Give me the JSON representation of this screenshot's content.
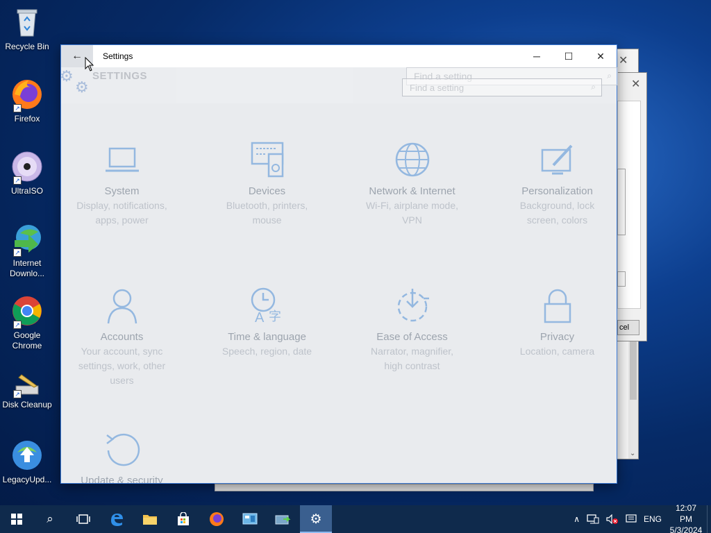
{
  "desktop": {
    "icons": [
      {
        "label": "Recycle Bin",
        "icon": "recycle-bin-icon"
      },
      {
        "label": "Firefox",
        "icon": "firefox-icon"
      },
      {
        "label": "UltraISO",
        "icon": "ultraiso-icon"
      },
      {
        "label": "Internet Downlo...",
        "icon": "internet-download-manager-icon"
      },
      {
        "label": "Google Chrome",
        "icon": "chrome-icon"
      },
      {
        "label": "Disk Cleanup",
        "icon": "disk-cleanup-icon"
      },
      {
        "label": "LegacyUpd...",
        "icon": "legacy-update-icon"
      }
    ]
  },
  "background_dialog": {
    "cancel_fragment": "cel"
  },
  "settings": {
    "window_title": "Settings",
    "header_title": "SETTINGS",
    "search_placeholder_1": "Find a setting",
    "search_placeholder_2": "Find a setting",
    "tiles": [
      {
        "title": "System",
        "desc": "Display, notifications, apps, power",
        "icon": "laptop-icon"
      },
      {
        "title": "Devices",
        "desc": "Bluetooth, printers, mouse",
        "icon": "devices-icon"
      },
      {
        "title": "Network & Internet",
        "desc": "Wi-Fi, airplane mode, VPN",
        "icon": "globe-icon"
      },
      {
        "title": "Personalization",
        "desc": "Background, lock screen, colors",
        "icon": "paintbrush-icon"
      },
      {
        "title": "Accounts",
        "desc": "Your account, sync settings, work, other users",
        "icon": "person-icon"
      },
      {
        "title": "Time & language",
        "desc": "Speech, region, date",
        "icon": "clock-language-icon"
      },
      {
        "title": "Ease of Access",
        "desc": "Narrator, magnifier, high contrast",
        "icon": "ease-of-access-icon"
      },
      {
        "title": "Privacy",
        "desc": "Location, camera",
        "icon": "lock-icon"
      },
      {
        "title": "Update & security",
        "desc": "",
        "icon": "update-icon"
      }
    ]
  },
  "taskbar": {
    "language": "ENG",
    "time": "12:07 PM",
    "date": "5/3/2024"
  },
  "colors": {
    "accent": "#3d7bd6",
    "tile_icon": "#7fb0e3",
    "taskbar": "#0f2a4c"
  }
}
